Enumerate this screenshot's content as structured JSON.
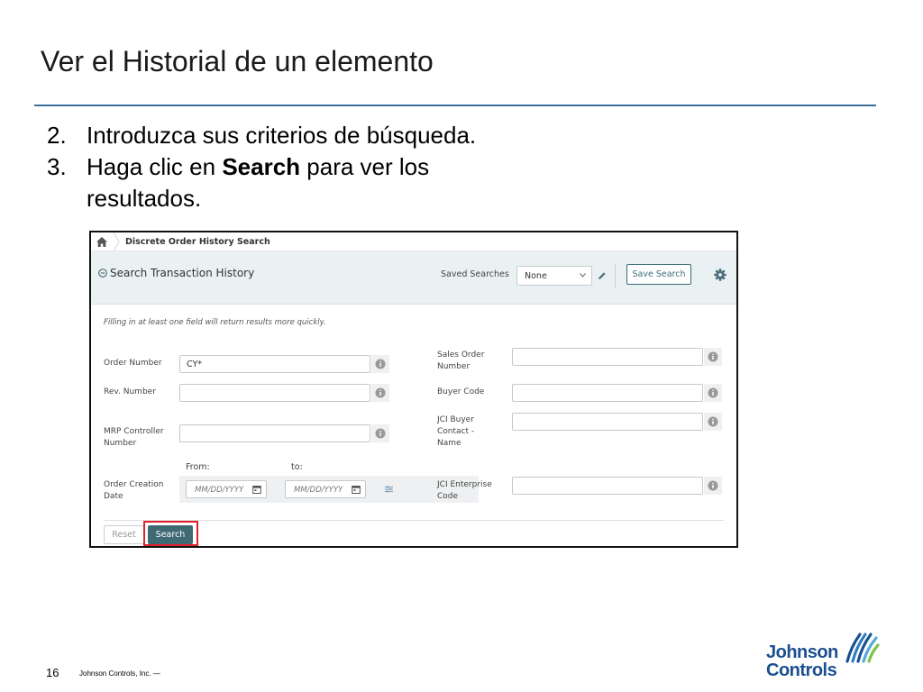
{
  "slide": {
    "title": "Ver el Historial de un elemento",
    "steps": [
      {
        "num": "2.",
        "text_before": "Introduzca sus criterios de búsqueda.",
        "bold": "",
        "text_after": ""
      },
      {
        "num": "3.",
        "text_before": "Haga clic en ",
        "bold": "Search",
        "text_after": " para ver los resultados."
      }
    ],
    "page_number": "16",
    "footer_company": "Johnson Controls, Inc. —",
    "logo_line1": "Johnson",
    "logo_line2": "Controls"
  },
  "app": {
    "breadcrumb": {
      "home_icon": "home-icon",
      "current": "Discrete Order History Search"
    },
    "header": {
      "collapse_icon": "minus-circle-icon",
      "title": "Search Transaction History",
      "saved_searches_label": "Saved Searches",
      "saved_searches_value": "None",
      "save_search_label": "Save Search",
      "settings_icon": "gear-icon"
    },
    "hint": "Filling in at least one field will return results more quickly.",
    "fields": {
      "order_number": {
        "label": "Order Number",
        "value": "CY*"
      },
      "rev_number": {
        "label": "Rev. Number",
        "value": ""
      },
      "mrp_controller": {
        "label_line1": "MRP Controller",
        "label_line2": "Number",
        "value": ""
      },
      "order_creation_date": {
        "label_line1": "Order Creation",
        "label_line2": "Date",
        "from_label": "From:",
        "to_label": "to:",
        "from_placeholder": "MM/DD/YYYY",
        "to_placeholder": "MM/DD/YYYY"
      },
      "sales_order": {
        "label_line1": "Sales Order",
        "label_line2": "Number",
        "value": ""
      },
      "buyer_code": {
        "label": "Buyer Code",
        "value": ""
      },
      "jci_buyer_contact": {
        "label_line1": "JCI Buyer",
        "label_line2": "Contact -",
        "label_line3": "Name",
        "value": ""
      },
      "jci_enterprise_code": {
        "label_line1": "JCI Enterprise",
        "label_line2": "Code",
        "value": ""
      }
    },
    "buttons": {
      "reset": "Reset",
      "search": "Search"
    },
    "colors": {
      "header_bg": "#eaf1f2",
      "primary_button": "#3f6a74",
      "highlight": "#e0212a",
      "title_rule": "#3a6f9a",
      "logo_blue": "#1b4f8f"
    }
  }
}
